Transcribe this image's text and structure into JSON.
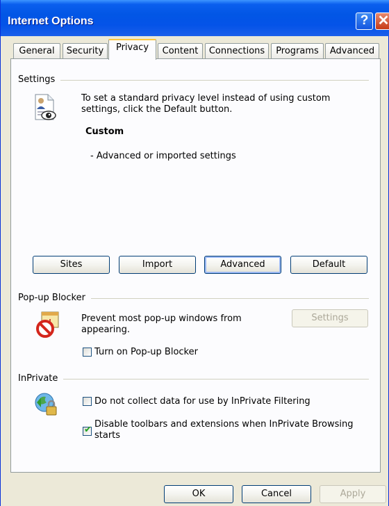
{
  "window": {
    "title": "Internet Options"
  },
  "tabs": [
    {
      "label": "General"
    },
    {
      "label": "Security"
    },
    {
      "label": "Privacy",
      "active": true
    },
    {
      "label": "Content"
    },
    {
      "label": "Connections"
    },
    {
      "label": "Programs"
    },
    {
      "label": "Advanced"
    }
  ],
  "settings": {
    "group_label": "Settings",
    "description_line1": "To set a standard privacy level instead of using custom",
    "description_line2": "settings, click the Default button.",
    "level_name": "Custom",
    "level_detail": "- Advanced or imported settings",
    "buttons": {
      "sites": "Sites",
      "import": "Import",
      "advanced": "Advanced",
      "default": "Default"
    }
  },
  "popup_blocker": {
    "group_label": "Pop-up Blocker",
    "description_line1": "Prevent most pop-up windows from",
    "description_line2": "appearing.",
    "settings_button": "Settings",
    "checkbox_label": "Turn on Pop-up Blocker",
    "checked": false
  },
  "inprivate": {
    "group_label": "InPrivate",
    "option1_label": "Do not collect data for use by InPrivate Filtering",
    "option1_checked": false,
    "option2_line1": "Disable toolbars and extensions when InPrivate Browsing",
    "option2_line2": "starts",
    "option2_checked": true
  },
  "footer": {
    "ok": "OK",
    "cancel": "Cancel",
    "apply": "Apply"
  }
}
